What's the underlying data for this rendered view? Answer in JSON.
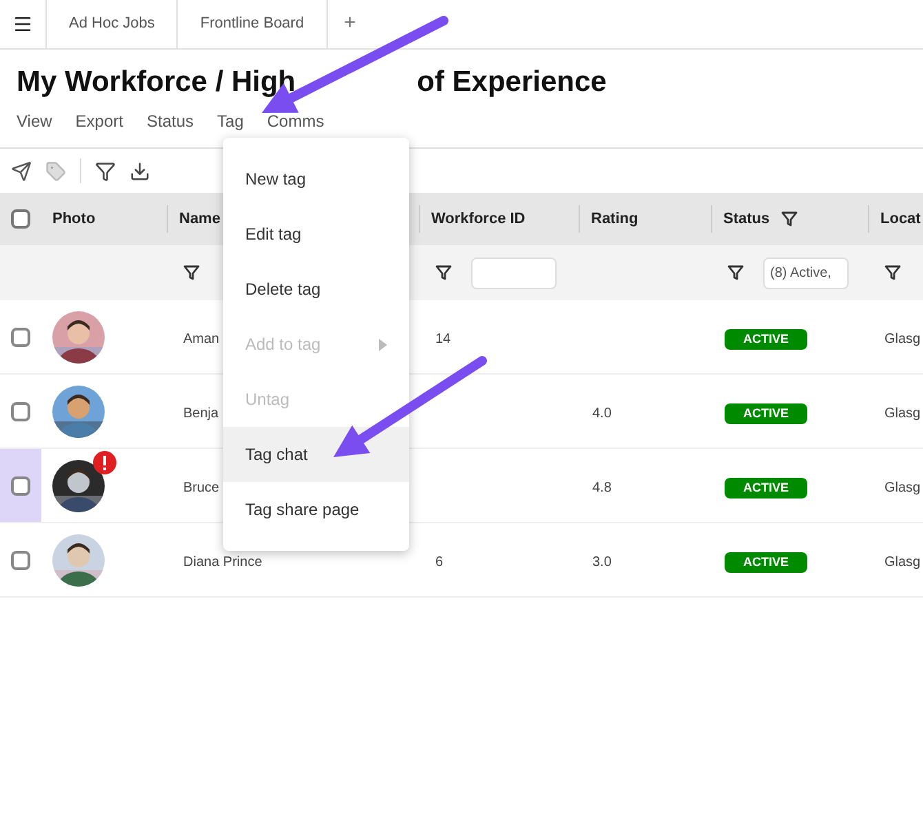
{
  "tabs": [
    {
      "label": "Ad Hoc Jobs",
      "selected": false
    },
    {
      "label": "Frontline Board",
      "selected": false
    }
  ],
  "add_tab": "+",
  "title": [
    "My Workforce / High",
    "of Experience"
  ],
  "menu_bar": [
    "View",
    "Export",
    "Status",
    "Tag",
    "Comms"
  ],
  "table": {
    "select_all_checked": false,
    "columns": [
      {
        "label": "Photo"
      },
      {
        "label": "Name"
      },
      {
        "label": "Workforce ID"
      },
      {
        "label": "Rating"
      },
      {
        "label": "Status",
        "filter_icon": true
      },
      {
        "label": "Locat"
      }
    ],
    "filter_row": [
      {
        "kind": "none"
      },
      {
        "kind": "icon"
      },
      {
        "kind": "input"
      },
      {
        "kind": "none"
      },
      {
        "kind": "input",
        "value": "(8) Active,"
      },
      {
        "kind": "icon"
      }
    ],
    "rows": [
      {
        "name": "Aman",
        "workforce_id": "14",
        "status": "ACTIVE",
        "location": "Glasg",
        "checked": false,
        "alert": false,
        "highlighted": false
      },
      {
        "name": "Benja",
        "rating": "4.0",
        "status": "ACTIVE",
        "location": "Glasg",
        "checked": false,
        "alert": false,
        "highlighted": false
      },
      {
        "name": "Bruce",
        "rating": "4.8",
        "status": "ACTIVE",
        "location": "Glasg",
        "checked": false,
        "alert": true,
        "highlighted": true
      },
      {
        "name": "Diana Prince",
        "workforce_id": "6",
        "rating": "3.0",
        "status": "ACTIVE",
        "location": "Glasg",
        "checked": false,
        "alert": false,
        "highlighted": false
      }
    ]
  },
  "tag_menu": [
    {
      "label": "New tag",
      "disabled": false,
      "submenu": false,
      "hovered": false
    },
    {
      "label": "Edit tag",
      "disabled": false,
      "submenu": false,
      "hovered": false
    },
    {
      "label": "Delete tag",
      "disabled": false,
      "submenu": false,
      "hovered": false
    },
    {
      "label": "Add to tag",
      "disabled": true,
      "submenu": true,
      "hovered": false
    },
    {
      "label": "Untag",
      "disabled": true,
      "submenu": false,
      "hovered": false
    },
    {
      "label": "Tag chat",
      "disabled": false,
      "submenu": false,
      "hovered": true
    },
    {
      "label": "Tag share page",
      "disabled": false,
      "submenu": false,
      "hovered": false
    }
  ]
}
